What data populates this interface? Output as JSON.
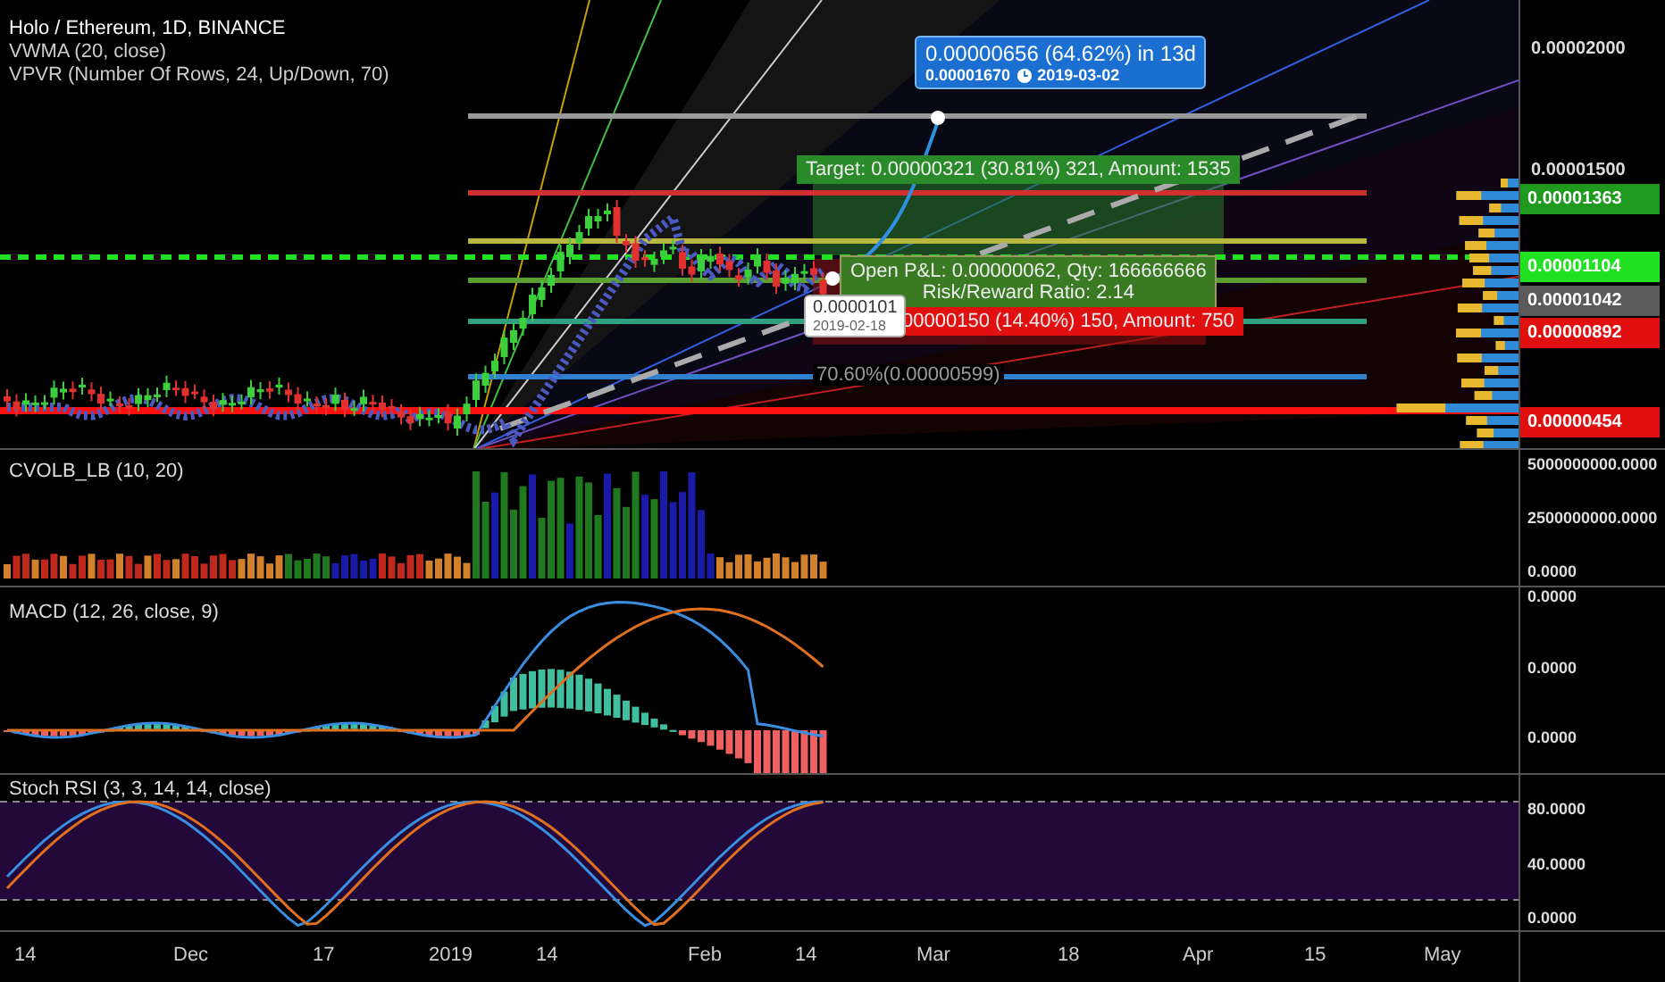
{
  "legend": {
    "title": "Holo / Ethereum, 1D, BINANCE",
    "indicators": [
      "VWMA (20, close)",
      "VPVR (Number Of Rows, 24, Up/Down, 70)"
    ]
  },
  "price_axis": {
    "ticks": [
      "0.00002000",
      "0.00001500"
    ],
    "tags": [
      {
        "text": "0.00001363",
        "color": "#1f9a1f"
      },
      {
        "text": "0.00001104",
        "color": "#22e022"
      },
      {
        "text": "0.00001042",
        "color": "#5a5a5a"
      },
      {
        "text": "0.00000892",
        "color": "#e01010"
      },
      {
        "text": "0.00000454",
        "color": "#e01010"
      }
    ]
  },
  "projection": {
    "change": "0.00000656 (64.62%) in 13d",
    "price": "0.00001670",
    "date": "2019-03-02"
  },
  "position": {
    "target": "Target: 0.00000321 (30.81%) 321, Amount: 1535",
    "open_pnl": "Open P&L: 0.00000062, Qty: 166666666",
    "risk_reward": "Risk/Reward Ratio: 2.14",
    "stop": "00000150 (14.40%) 150, Amount: 750"
  },
  "fib_labels": [
    "70.60%(0.00000599)"
  ],
  "cursor": {
    "price": "0.0000101",
    "date": "2019-02-18"
  },
  "panes": [
    {
      "kind": "volume",
      "title": "CVOLB_LB (10, 20)",
      "ticks": [
        "5000000000.0000",
        "2500000000.0000",
        "0.0000"
      ]
    },
    {
      "kind": "macd",
      "title": "MACD (12, 26, close, 9)",
      "ticks": [
        "0.0000",
        "0.0000",
        "0.0000"
      ]
    },
    {
      "kind": "stoch",
      "title": "Stoch RSI (3, 3, 14, 14, close)",
      "ticks": [
        "80.0000",
        "40.0000",
        "0.0000"
      ]
    }
  ],
  "time_axis": [
    "14",
    "Dec",
    "17",
    "2019",
    "14",
    "Feb",
    "14",
    "Mar",
    "18",
    "Apr",
    "15",
    "May"
  ]
}
